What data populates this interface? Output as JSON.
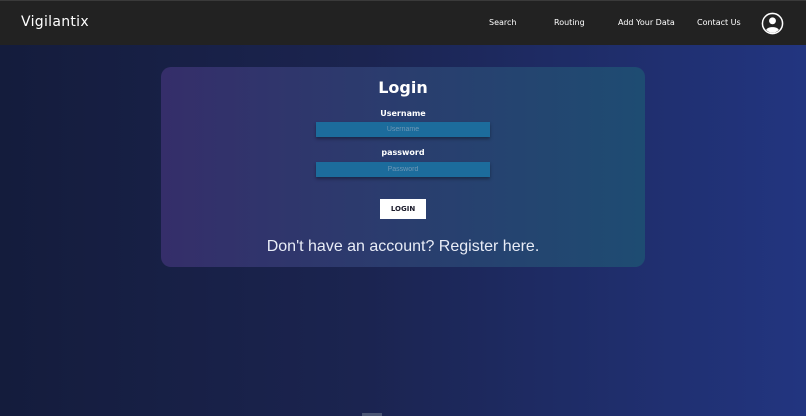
{
  "header": {
    "brand": "Vigilantix",
    "nav": {
      "search": "Search",
      "routing": "Routing",
      "add_data": "Add Your Data",
      "contact": "Contact Us"
    },
    "profile_icon": "user-circle-icon"
  },
  "login": {
    "title": "Login",
    "username_label": "Username",
    "username_placeholder": "Username",
    "username_value": "",
    "password_label": "password",
    "password_placeholder": "Password",
    "password_value": "",
    "button_label": "LOGIN",
    "register_text": "Don't have an account? Register here."
  },
  "colors": {
    "navbar": "#222222",
    "background_start": "#141c3c",
    "background_end": "#223580",
    "input_fill": "#1c6c9c",
    "button_fill": "#ffffff"
  }
}
